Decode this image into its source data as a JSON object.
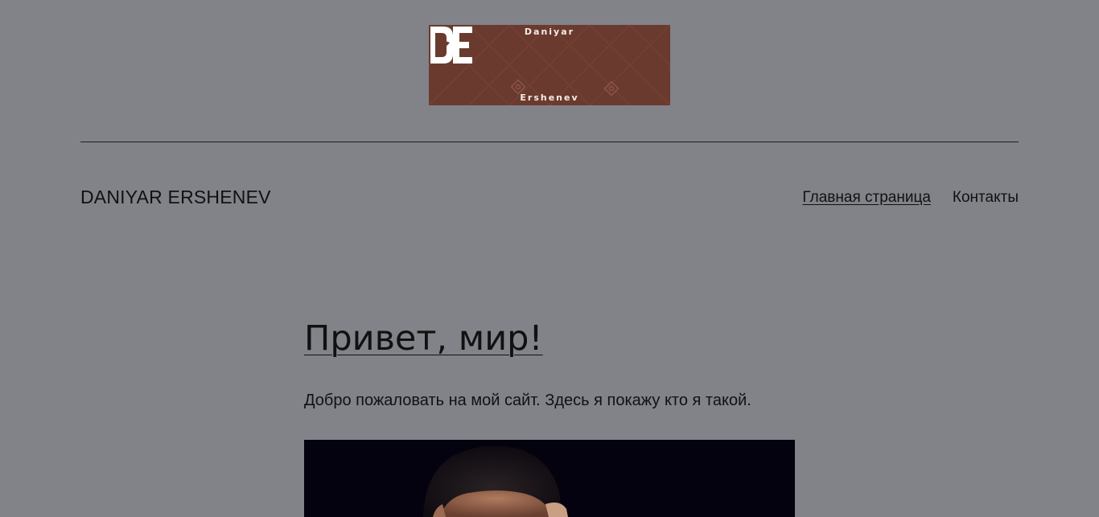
{
  "logo": {
    "name_top": "Daniyar",
    "initials": "DE",
    "name_bottom": "Ershenev",
    "background": "#6b3a2e"
  },
  "header": {
    "site_title": "DANIYAR ERSHENEV",
    "nav": [
      {
        "label": "Главная страница",
        "current": true
      },
      {
        "label": "Контакты",
        "current": false
      }
    ]
  },
  "post": {
    "title": "Привет, мир!",
    "text": "Добро пожаловать на мой сайт. Здесь я покажу кто я такой.",
    "image_background": "#04020f"
  },
  "colors": {
    "page_background": "#818389",
    "text": "#111111"
  }
}
